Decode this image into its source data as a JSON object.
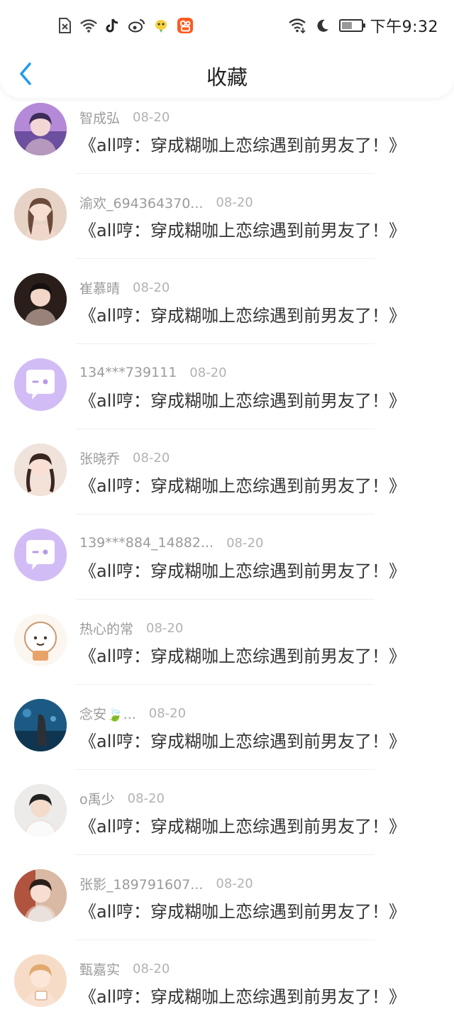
{
  "status_bar": {
    "time": "下午9:32",
    "left_icons": [
      "sim-off-icon",
      "wifi-icon",
      "tiktok-icon",
      "weibo-icon",
      "bird-app-icon",
      "kuaishou-icon"
    ],
    "right_icons": [
      "wifi-signal-icon",
      "moon-icon",
      "battery-icon"
    ],
    "battery_level": 0.55
  },
  "header": {
    "title": "收藏",
    "back_icon": "chevron-left-icon",
    "accent_color": "#1E9BF0"
  },
  "favorites": [
    {
      "user": "智成弘",
      "date": "08-20",
      "book": "《all哼：穿成糊咖上恋综遇到前男友了！》",
      "avatar_bg": "#8a6bb0"
    },
    {
      "user": "渝欢_694364370...",
      "date": "08-20",
      "book": "《all哼：穿成糊咖上恋综遇到前男友了！》",
      "avatar_bg": "#d8b7a3"
    },
    {
      "user": "崔慕晴",
      "date": "08-20",
      "book": "《all哼：穿成糊咖上恋综遇到前男友了！》",
      "avatar_bg": "#3a2a25"
    },
    {
      "user": "134***739111",
      "date": "08-20",
      "book": "《all哼：穿成糊咖上恋综遇到前男友了！》",
      "avatar_bg": "#cdb5f2"
    },
    {
      "user": "张晓乔",
      "date": "08-20",
      "book": "《all哼：穿成糊咖上恋综遇到前男友了！》",
      "avatar_bg": "#e9d6cc"
    },
    {
      "user": "139***884_14882...",
      "date": "08-20",
      "book": "《all哼：穿成糊咖上恋综遇到前男友了！》",
      "avatar_bg": "#cdb5f2"
    },
    {
      "user": "热心的常",
      "date": "08-20",
      "book": "《all哼：穿成糊咖上恋综遇到前男友了！》",
      "avatar_bg": "#f7efe6"
    },
    {
      "user": "念安🍃...",
      "date": "08-20",
      "book": "《all哼：穿成糊咖上恋综遇到前男友了！》",
      "avatar_bg": "#1f4e6b"
    },
    {
      "user": "o禹少",
      "date": "08-20",
      "book": "《all哼：穿成糊咖上恋综遇到前男友了！》",
      "avatar_bg": "#e8e6e4"
    },
    {
      "user": "张影_189791607...",
      "date": "08-20",
      "book": "《all哼：穿成糊咖上恋综遇到前男友了！》",
      "avatar_bg": "#c9a08a"
    },
    {
      "user": "甄嘉实",
      "date": "08-20",
      "book": "《all哼：穿成糊咖上恋综遇到前男友了！》",
      "avatar_bg": "#f3d9c2"
    }
  ]
}
